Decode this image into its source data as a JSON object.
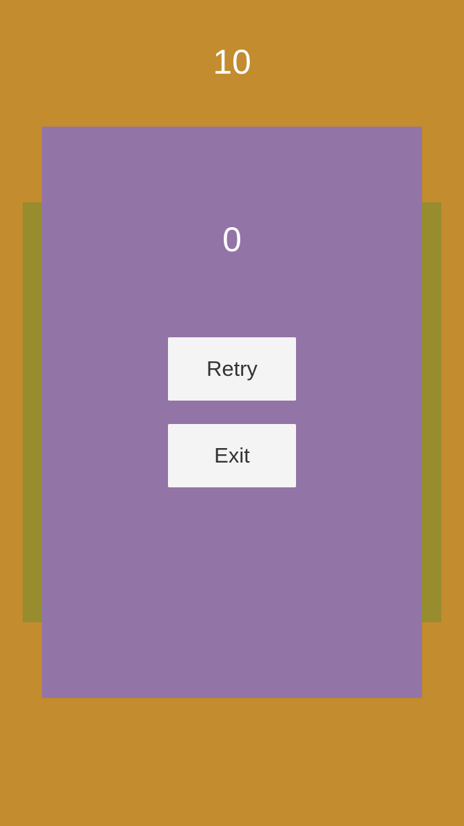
{
  "colors": {
    "background": "#c28c2f",
    "board": "#978c2e",
    "overlay": "#9374a6",
    "button": "#f4f4f4",
    "button_text": "#333333",
    "score_text": "#ffffff"
  },
  "header": {
    "score": "10"
  },
  "game_over_panel": {
    "score": "0",
    "retry_label": "Retry",
    "exit_label": "Exit"
  }
}
